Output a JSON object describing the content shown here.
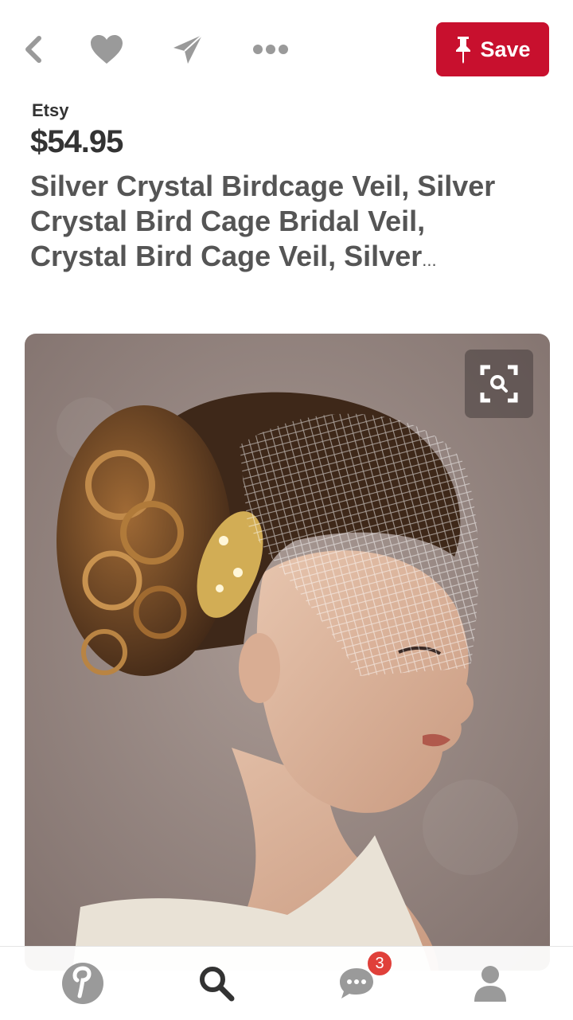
{
  "header": {
    "save_label": "Save",
    "icons": [
      "back-chevron-icon",
      "heart-icon",
      "send-icon",
      "more-icon"
    ]
  },
  "pin": {
    "source": "Etsy",
    "price": "$54.95",
    "title": "Silver Crystal Birdcage Veil, Silver Crystal Bird Cage Bridal Veil, Crystal Bird Cage Veil, Silver",
    "title_ellipsis": "..."
  },
  "image": {
    "alt": "Bride with curly updo wearing a birdcage veil and gold crystal hair comb",
    "lens_icon": "visual-search-icon"
  },
  "bottom_nav": {
    "items": [
      "pinterest-home-icon",
      "search-icon",
      "messages-icon",
      "profile-icon"
    ],
    "messages_badge": "3"
  },
  "colors": {
    "accent": "#c8102e",
    "icon_gray": "#9a9a9a",
    "badge": "#e0403a"
  }
}
